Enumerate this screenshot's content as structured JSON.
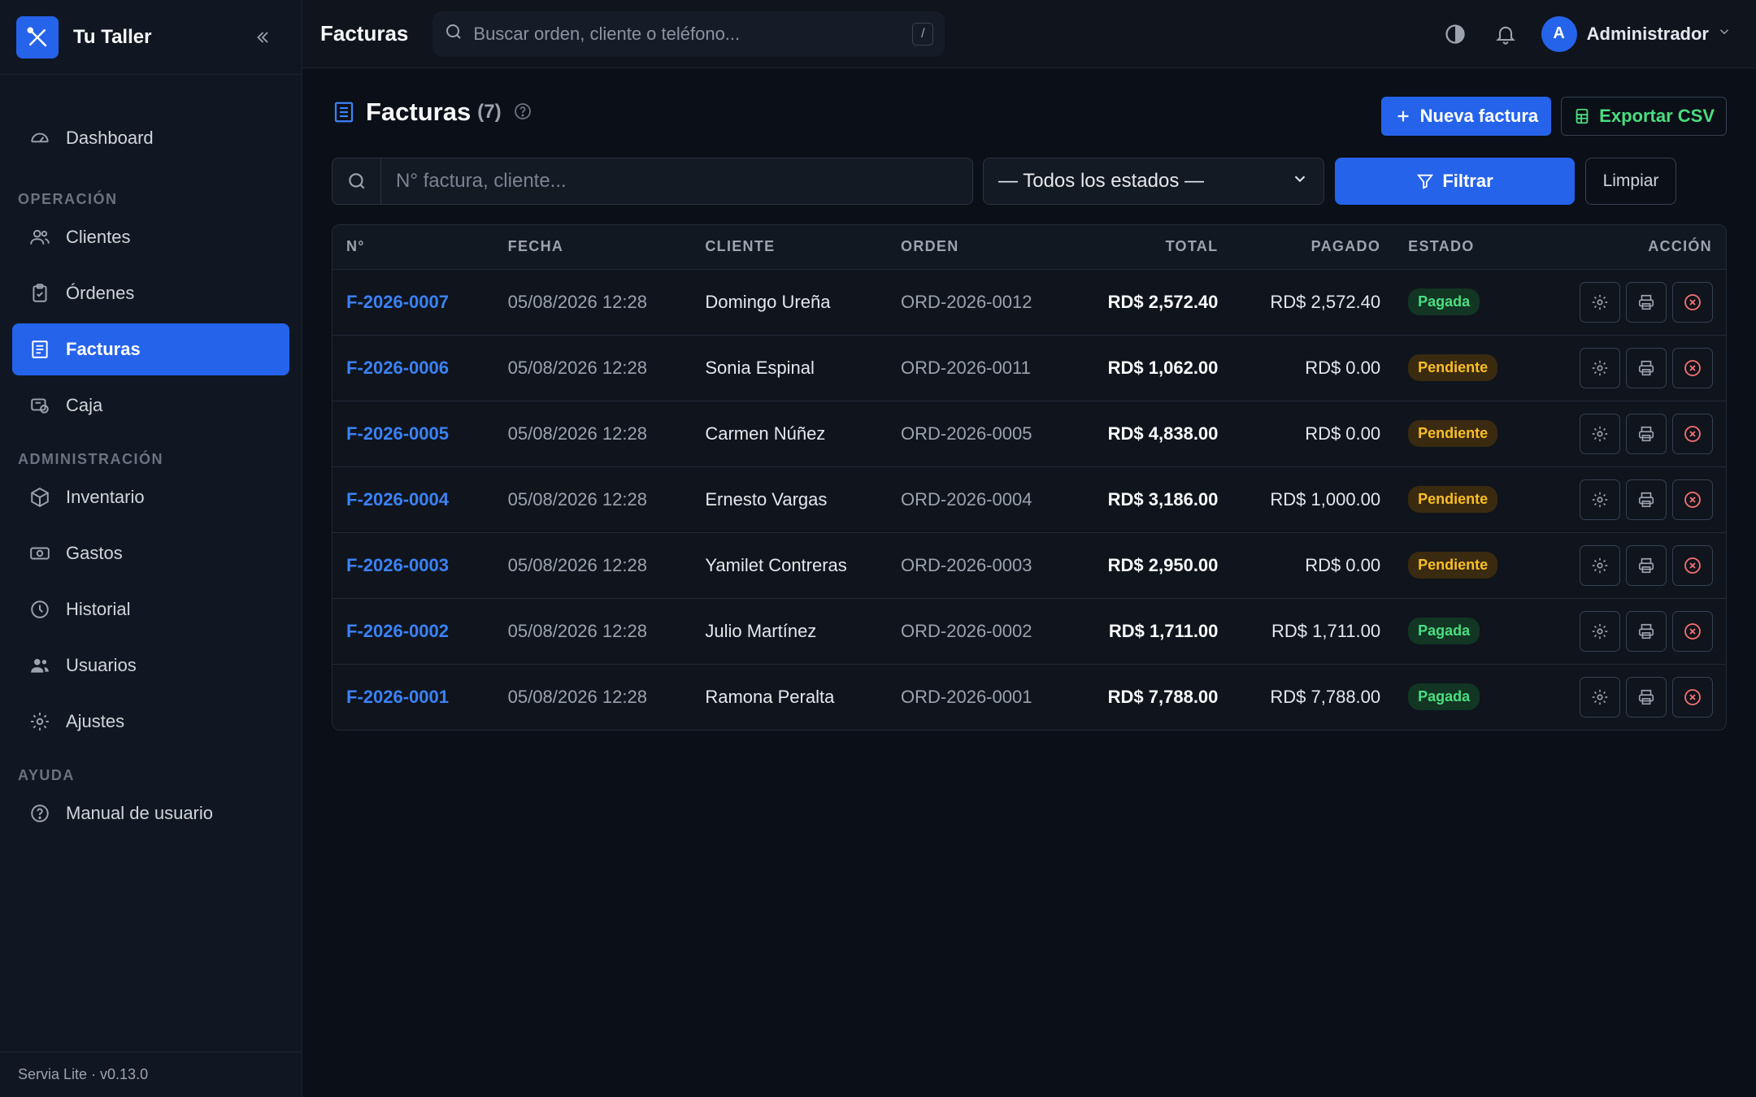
{
  "app": {
    "brand_name": "Tu Taller",
    "version": "Servia Lite · v0.13.0",
    "accent_color": "#2563eb"
  },
  "sidebar": {
    "top_item": {
      "label": "Dashboard",
      "icon": "gauge-icon"
    },
    "sections": [
      {
        "title": "OPERACIÓN",
        "items": [
          {
            "label": "Clientes",
            "icon": "users-icon"
          },
          {
            "label": "Órdenes",
            "icon": "clipboard-icon"
          },
          {
            "label": "Facturas",
            "icon": "invoice-icon",
            "active": true
          },
          {
            "label": "Caja",
            "icon": "cash-register-icon"
          }
        ]
      },
      {
        "title": "ADMINISTRACIÓN",
        "items": [
          {
            "label": "Inventario",
            "icon": "box-icon"
          },
          {
            "label": "Gastos",
            "icon": "banknote-icon"
          },
          {
            "label": "Historial",
            "icon": "clock-icon"
          },
          {
            "label": "Usuarios",
            "icon": "users-icon"
          },
          {
            "label": "Ajustes",
            "icon": "gear-icon"
          }
        ]
      },
      {
        "title": "AYUDA",
        "items": [
          {
            "label": "Manual de usuario",
            "icon": "help-circle-icon"
          }
        ]
      }
    ]
  },
  "topbar": {
    "title": "Facturas",
    "search_placeholder": "Buscar orden, cliente o teléfono...",
    "search_shortcut": "/",
    "user_initial": "A",
    "user_name": "Administrador"
  },
  "page": {
    "title": "Facturas",
    "count": "(7)",
    "new_button": "Nueva factura",
    "export_button": "Exportar CSV",
    "filter_placeholder": "N° factura, cliente...",
    "status_select": "— Todos los estados —",
    "filter_button": "Filtrar",
    "clear_button": "Limpiar"
  },
  "table": {
    "columns": [
      "N°",
      "FECHA",
      "CLIENTE",
      "ORDEN",
      "TOTAL",
      "PAGADO",
      "ESTADO",
      "ACCIÓN"
    ],
    "rows": [
      {
        "num": "F-2026-0007",
        "date": "05/08/2026 12:28",
        "client": "Domingo Ureña",
        "order": "ORD-2026-0012",
        "total": "RD$ 2,572.40",
        "paid": "RD$ 2,572.40",
        "status": "Pagada",
        "status_key": "pagada"
      },
      {
        "num": "F-2026-0006",
        "date": "05/08/2026 12:28",
        "client": "Sonia Espinal",
        "order": "ORD-2026-0011",
        "total": "RD$ 1,062.00",
        "paid": "RD$ 0.00",
        "status": "Pendiente",
        "status_key": "pendiente"
      },
      {
        "num": "F-2026-0005",
        "date": "05/08/2026 12:28",
        "client": "Carmen Núñez",
        "order": "ORD-2026-0005",
        "total": "RD$ 4,838.00",
        "paid": "RD$ 0.00",
        "status": "Pendiente",
        "status_key": "pendiente"
      },
      {
        "num": "F-2026-0004",
        "date": "05/08/2026 12:28",
        "client": "Ernesto Vargas",
        "order": "ORD-2026-0004",
        "total": "RD$ 3,186.00",
        "paid": "RD$ 1,000.00",
        "status": "Pendiente",
        "status_key": "pendiente"
      },
      {
        "num": "F-2026-0003",
        "date": "05/08/2026 12:28",
        "client": "Yamilet Contreras",
        "order": "ORD-2026-0003",
        "total": "RD$ 2,950.00",
        "paid": "RD$ 0.00",
        "status": "Pendiente",
        "status_key": "pendiente"
      },
      {
        "num": "F-2026-0002",
        "date": "05/08/2026 12:28",
        "client": "Julio Martínez",
        "order": "ORD-2026-0002",
        "total": "RD$ 1,711.00",
        "paid": "RD$ 1,711.00",
        "status": "Pagada",
        "status_key": "pagada"
      },
      {
        "num": "F-2026-0001",
        "date": "05/08/2026 12:28",
        "client": "Ramona Peralta",
        "order": "ORD-2026-0001",
        "total": "RD$ 7,788.00",
        "paid": "RD$ 7,788.00",
        "status": "Pagada",
        "status_key": "pagada"
      }
    ]
  }
}
